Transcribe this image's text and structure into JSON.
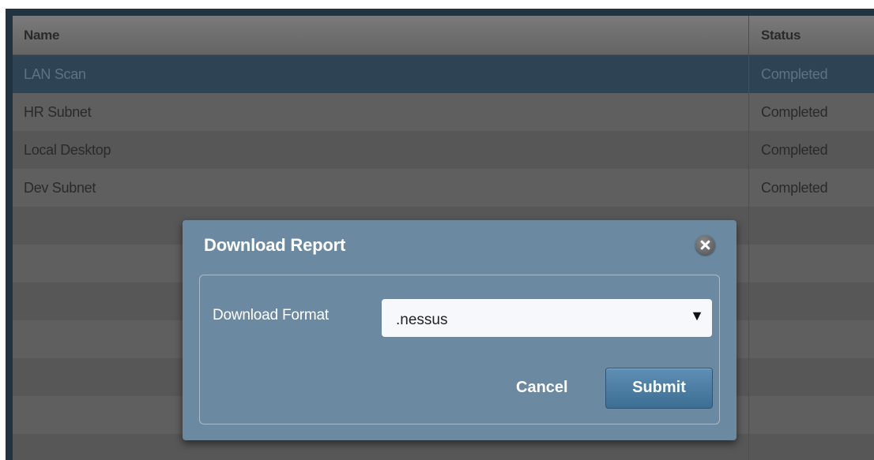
{
  "table": {
    "columns": {
      "name": "Name",
      "status": "Status"
    },
    "rows": [
      {
        "name": "LAN Scan",
        "status": "Completed",
        "selected": true
      },
      {
        "name": "HR Subnet",
        "status": "Completed"
      },
      {
        "name": "Local Desktop",
        "status": "Completed"
      },
      {
        "name": "Dev Subnet",
        "status": "Completed"
      }
    ]
  },
  "dialog": {
    "title": "Download Report",
    "format_label": "Download Format",
    "format_selected": ".nessus",
    "cancel_label": "Cancel",
    "submit_label": "Submit"
  },
  "icons": {
    "close": "close-icon",
    "dropdown": "caret-down-icon"
  },
  "colors": {
    "selected_row": "#2e4455",
    "dialog_bg": "#6b8aa1",
    "submit_button": "#4a7ca3"
  }
}
